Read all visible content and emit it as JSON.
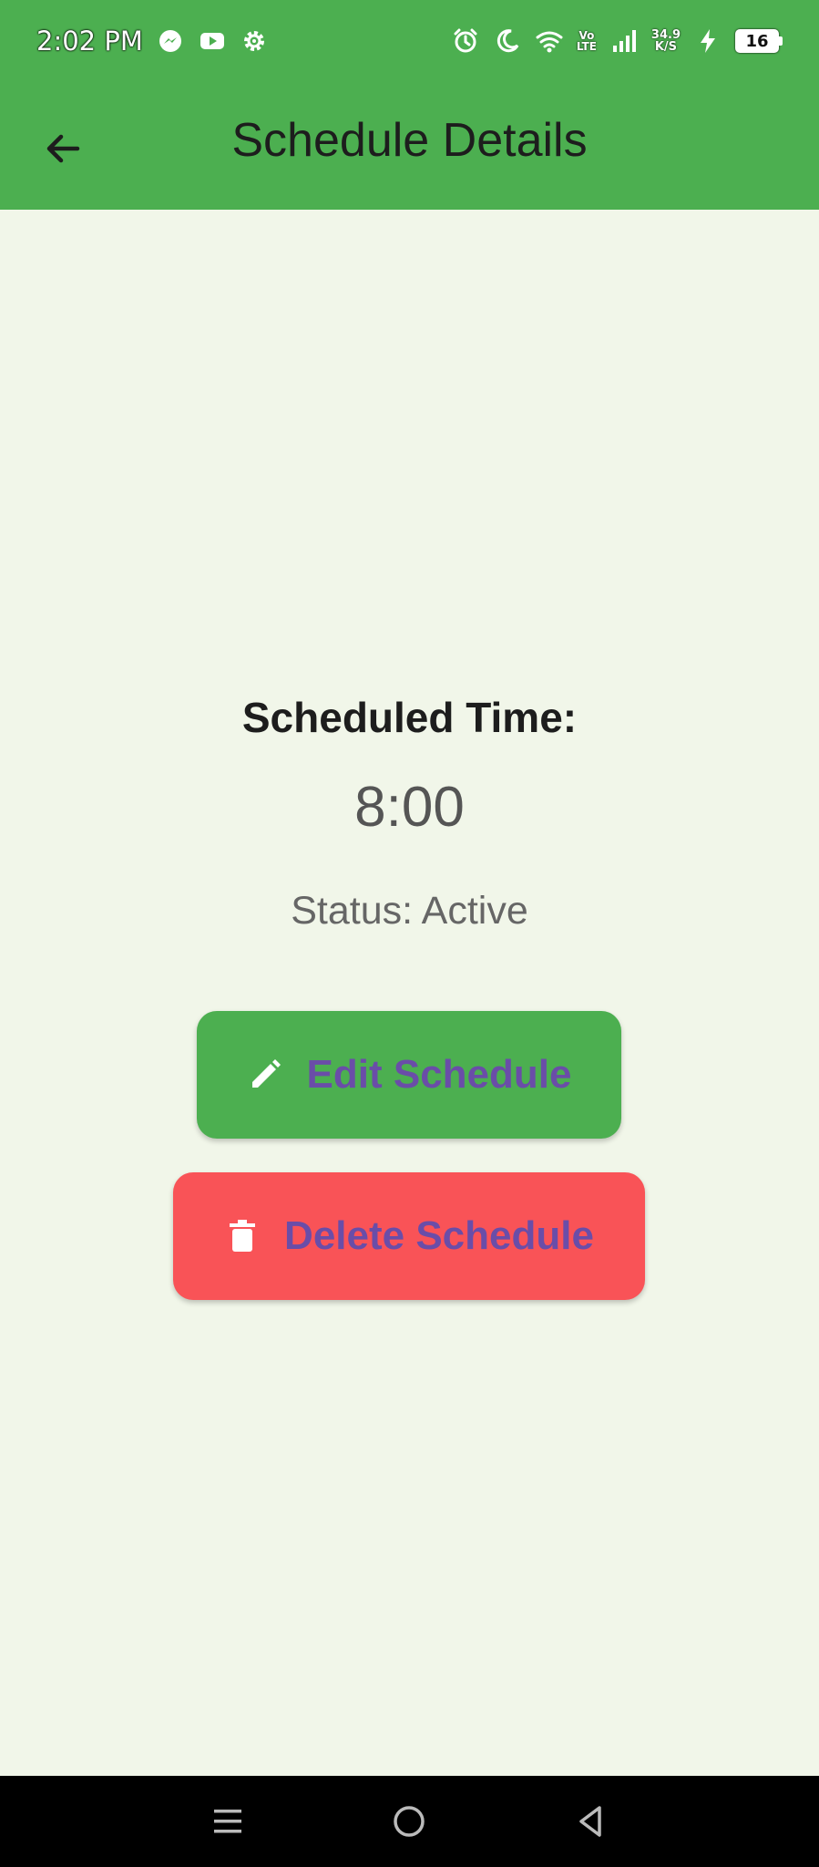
{
  "status_bar": {
    "time": "2:02 PM",
    "net_speed_value": "34.9",
    "net_speed_unit": "K/S",
    "volte_top": "Vo",
    "volte_bottom": "LTE",
    "battery": "16",
    "left_icons": [
      "messenger-icon",
      "youtube-icon",
      "settings-gear-icon"
    ],
    "right_icons": [
      "alarm-icon",
      "do-not-disturb-moon-icon",
      "wifi-icon",
      "signal-bars-icon",
      "charging-bolt-icon"
    ]
  },
  "app_bar": {
    "title": "Schedule Details",
    "back_icon": "arrow-back-icon"
  },
  "main": {
    "label": "Scheduled Time:",
    "time": "8:00",
    "status": "Status: Active"
  },
  "actions": {
    "edit_label": "Edit Schedule",
    "edit_icon": "pencil-icon",
    "delete_label": "Delete Schedule",
    "delete_icon": "trash-icon"
  },
  "nav_bar": {
    "icons": [
      "menu-icon",
      "home-circle-icon",
      "back-triangle-icon"
    ]
  },
  "colors": {
    "primary": "#4CAF50",
    "background": "#F1F6E9",
    "delete": "#F95357",
    "button_text": "#6A4DA8"
  }
}
